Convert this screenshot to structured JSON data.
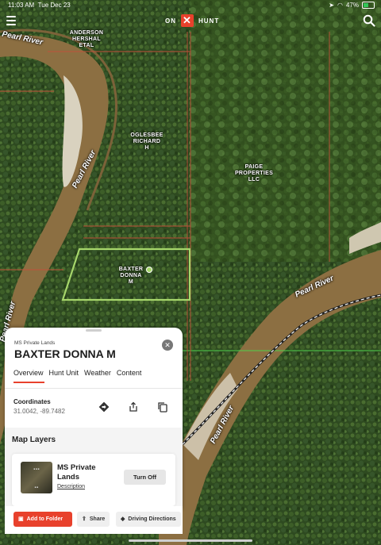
{
  "status_bar": {
    "time": "11:03 AM",
    "date": "Tue Dec 23",
    "battery": "47%",
    "battery_level": 0.47
  },
  "top_nav": {
    "logo_left": "ON",
    "logo_mark": "✕",
    "logo_right": "HUNT",
    "menu_icon": "hamburger-icon",
    "search_icon": "search-icon"
  },
  "map": {
    "parcels": [
      {
        "name": "ANDERSON\nHERSHAL\nETAL"
      },
      {
        "name": "OGLESBEE\nRICHARD\nH"
      },
      {
        "name": "PAIGE\nPROPERTIES\nLLC"
      },
      {
        "name": "BAXTER\nDONNA\nM"
      }
    ],
    "river_labels": [
      "Pearl River",
      "Pearl River",
      "Pearl River",
      "Pearl River",
      "Pearl River"
    ],
    "selected_color": "#a6d66b",
    "boundary_color": "#c0503a"
  },
  "panel": {
    "subtitle": "MS Private Lands",
    "title": "BAXTER DONNA M",
    "close_icon": "close-icon",
    "tabs": [
      {
        "label": "Overview",
        "active": true
      },
      {
        "label": "Hunt Unit",
        "active": false
      },
      {
        "label": "Weather",
        "active": false
      },
      {
        "label": "Content",
        "active": false
      }
    ],
    "coordinates_label": "Coordinates",
    "coordinates_value": "31.0042, -89.7482",
    "map_layers_title": "Map Layers",
    "layer": {
      "name": "MS Private Lands",
      "description": "Description",
      "button": "Turn Off"
    }
  },
  "actions": {
    "add_to_folder": "Add to Folder",
    "share": "Share",
    "driving_directions": "Driving Directions"
  },
  "accent_color": "#e8412c"
}
